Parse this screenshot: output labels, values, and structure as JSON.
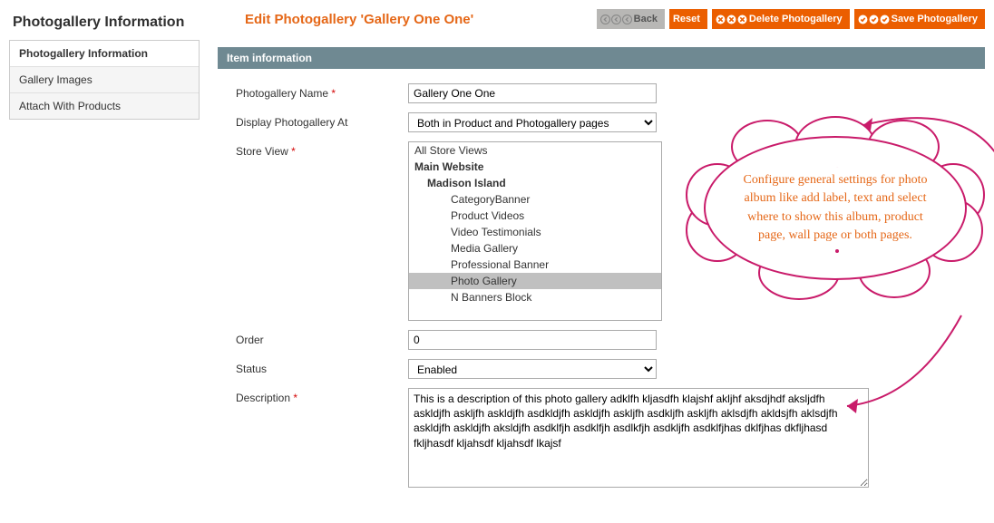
{
  "sidebar": {
    "title": "Photogallery Information",
    "tabs": [
      {
        "label": "Photogallery Information",
        "active": true
      },
      {
        "label": "Gallery Images",
        "active": false
      },
      {
        "label": "Attach With Products",
        "active": false
      }
    ]
  },
  "header": {
    "title": "Edit Photogallery 'Gallery One One'",
    "buttons": {
      "back": "Back",
      "reset": "Reset",
      "delete": "Delete Photogallery",
      "save": "Save Photogallery"
    }
  },
  "section": {
    "title": "Item information"
  },
  "fields": {
    "name": {
      "label": "Photogallery Name",
      "required": true,
      "value": "Gallery One One"
    },
    "display_at": {
      "label": "Display Photogallery At",
      "required": false,
      "value": "Both in Product and Photogallery pages"
    },
    "store_view": {
      "label": "Store View",
      "required": true,
      "options": [
        {
          "text": "All Store Views",
          "indent": 0,
          "bold": false,
          "selected": false
        },
        {
          "text": "Main Website",
          "indent": 0,
          "bold": true,
          "selected": false
        },
        {
          "text": "Madison Island",
          "indent": 1,
          "bold": true,
          "selected": false
        },
        {
          "text": "CategoryBanner",
          "indent": 2,
          "bold": false,
          "selected": false
        },
        {
          "text": "Product Videos",
          "indent": 2,
          "bold": false,
          "selected": false
        },
        {
          "text": "Video Testimonials",
          "indent": 2,
          "bold": false,
          "selected": false
        },
        {
          "text": "Media Gallery",
          "indent": 2,
          "bold": false,
          "selected": false
        },
        {
          "text": "Professional Banner",
          "indent": 2,
          "bold": false,
          "selected": false
        },
        {
          "text": "Photo Gallery",
          "indent": 2,
          "bold": false,
          "selected": true
        },
        {
          "text": "N Banners Block",
          "indent": 2,
          "bold": false,
          "selected": false
        }
      ]
    },
    "order": {
      "label": "Order",
      "required": false,
      "value": "0"
    },
    "status": {
      "label": "Status",
      "required": false,
      "value": "Enabled"
    },
    "description": {
      "label": "Description",
      "required": true,
      "value": "This is a description of this photo gallery adklfh kljasdfh klajshf akljhf aksdjhdf aksljdfh askldjfh askljfh askldjfh asdkldjfh askldjfh askljfh asdkljfh askljfh aklsdjfh akldsjfh aklsdjfh askldjfh askldjfh aksldjfh asdklfjh asdklfjh asdlkfjh asdkljfh asdklfjhas dklfjhas dkfljhasd fkljhasdf kljahsdf kljahsdf lkajsf"
    }
  },
  "annotation": {
    "text": "Configure general settings for photo album like add label, text and select where to show this album, product page, wall page or both pages."
  }
}
